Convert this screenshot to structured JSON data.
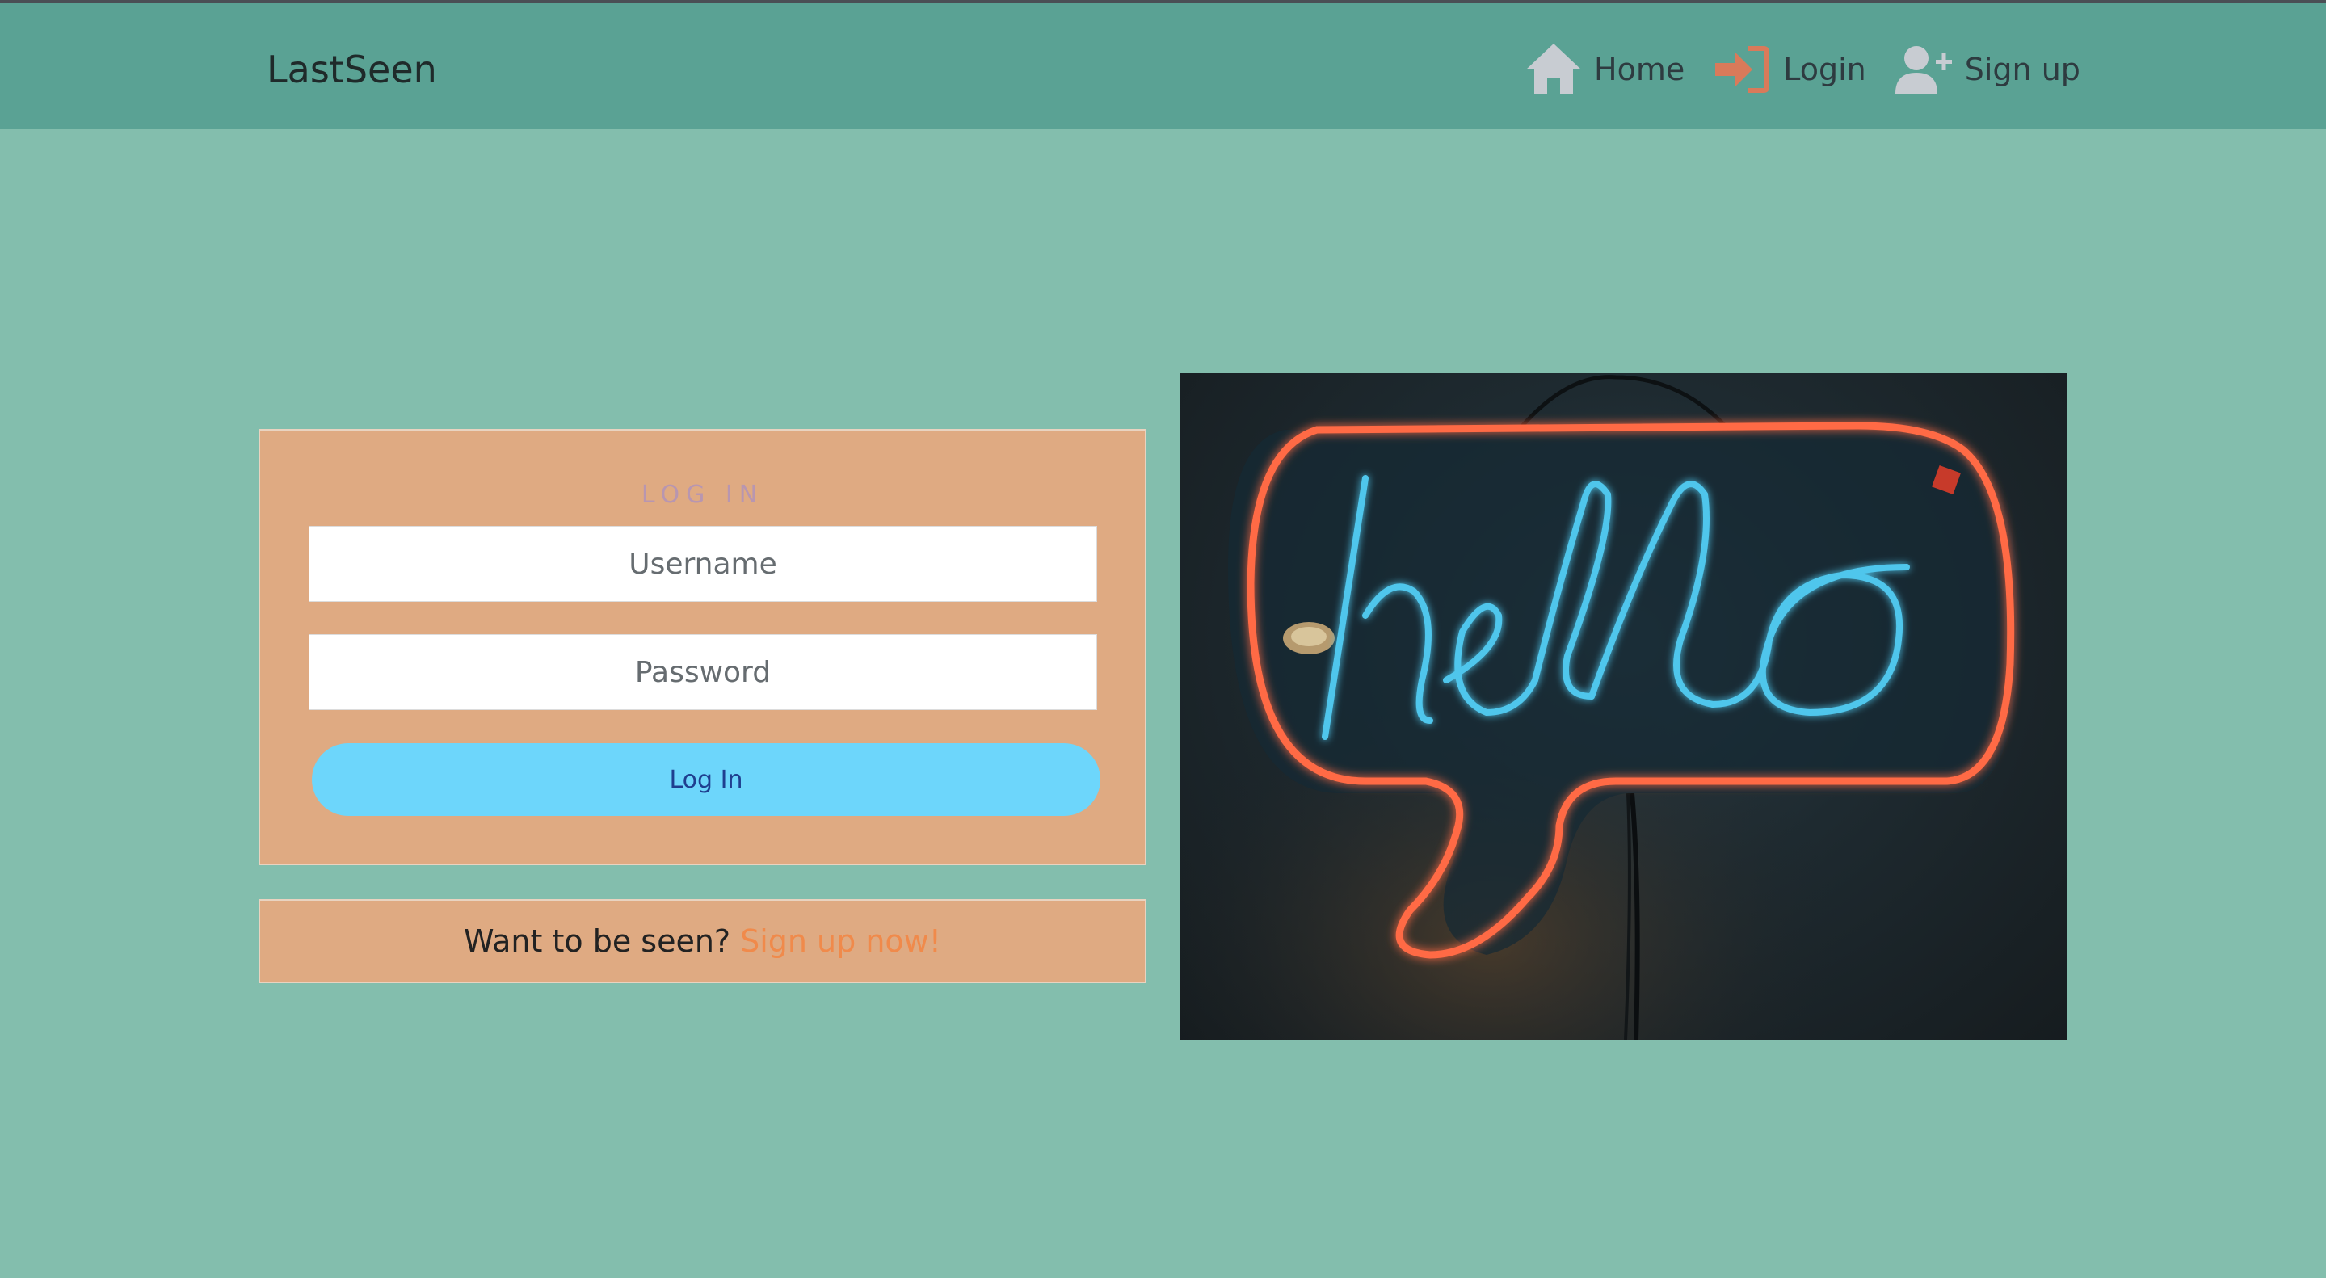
{
  "app": {
    "brand": "LastSeen"
  },
  "nav": {
    "items": [
      {
        "label": "Home",
        "icon": "home-icon"
      },
      {
        "label": "Login",
        "icon": "sign-in-icon"
      },
      {
        "label": "Sign up",
        "icon": "user-plus-icon"
      }
    ]
  },
  "login": {
    "title": "LOG IN",
    "username_placeholder": "Username",
    "password_placeholder": "Password",
    "button_label": "Log In"
  },
  "signup_prompt": {
    "text": "Want to be seen?",
    "link": "Sign up now!"
  },
  "image": {
    "subject": "neon-hello-sign",
    "text": "hello"
  },
  "colors": {
    "background": "#83bead",
    "navbar": "#5aa294",
    "card": "#dfaa82",
    "button": "#6dd6fb",
    "link": "#f08a4b",
    "neon_blue": "#4fc6ec",
    "neon_orange": "#ff6a45"
  }
}
